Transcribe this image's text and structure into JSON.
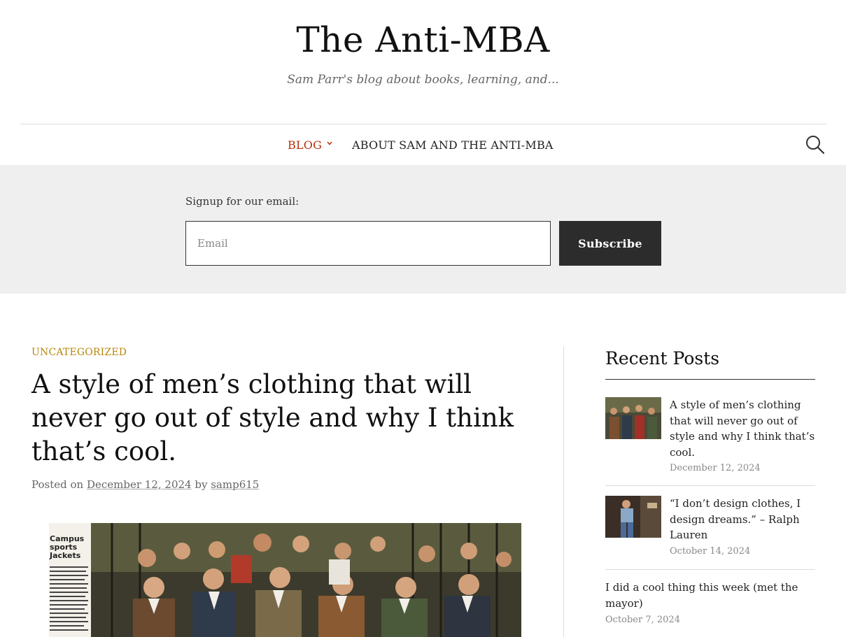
{
  "site": {
    "title": "The Anti-MBA",
    "tagline": "Sam Parr's blog about books, learning, and..."
  },
  "nav": {
    "items": [
      {
        "label": "BLOG",
        "active": true,
        "has_dropdown": true
      },
      {
        "label": "ABOUT SAM AND THE ANTI-MBA",
        "active": false,
        "has_dropdown": false
      }
    ],
    "search_icon": "search-icon",
    "chevron_icon": "chevron-down-icon"
  },
  "signup": {
    "label": "Signup for our email:",
    "email_placeholder": "Email",
    "email_value": "",
    "button_label": "Subscribe"
  },
  "post": {
    "category": "UNCATEGORIZED",
    "title": "A style of men’s clothing that will never go out of style and why I think that’s cool.",
    "posted_on_label": "Posted on",
    "date": "December 12, 2024",
    "by_label": "by",
    "author": "samp615",
    "image_text": {
      "heading": "Campus sports Jackets"
    }
  },
  "sidebar": {
    "widget_title": "Recent Posts",
    "recent_posts": [
      {
        "title": "A style of men’s clothing that will never go out of style and why I think that’s cool.",
        "date": "December 12, 2024",
        "has_thumb": true
      },
      {
        "title": "“I don’t design clothes, I design dreams.” – Ralph Lauren",
        "date": "October 14, 2024",
        "has_thumb": true
      },
      {
        "title": "I did a cool thing this week (met the mayor)",
        "date": "October 7, 2024",
        "has_thumb": false
      }
    ]
  },
  "colors": {
    "accent_nav": "#b5310c",
    "category": "#b8860b",
    "button_bg": "#2c2c2c",
    "signup_bg": "#efefef"
  }
}
